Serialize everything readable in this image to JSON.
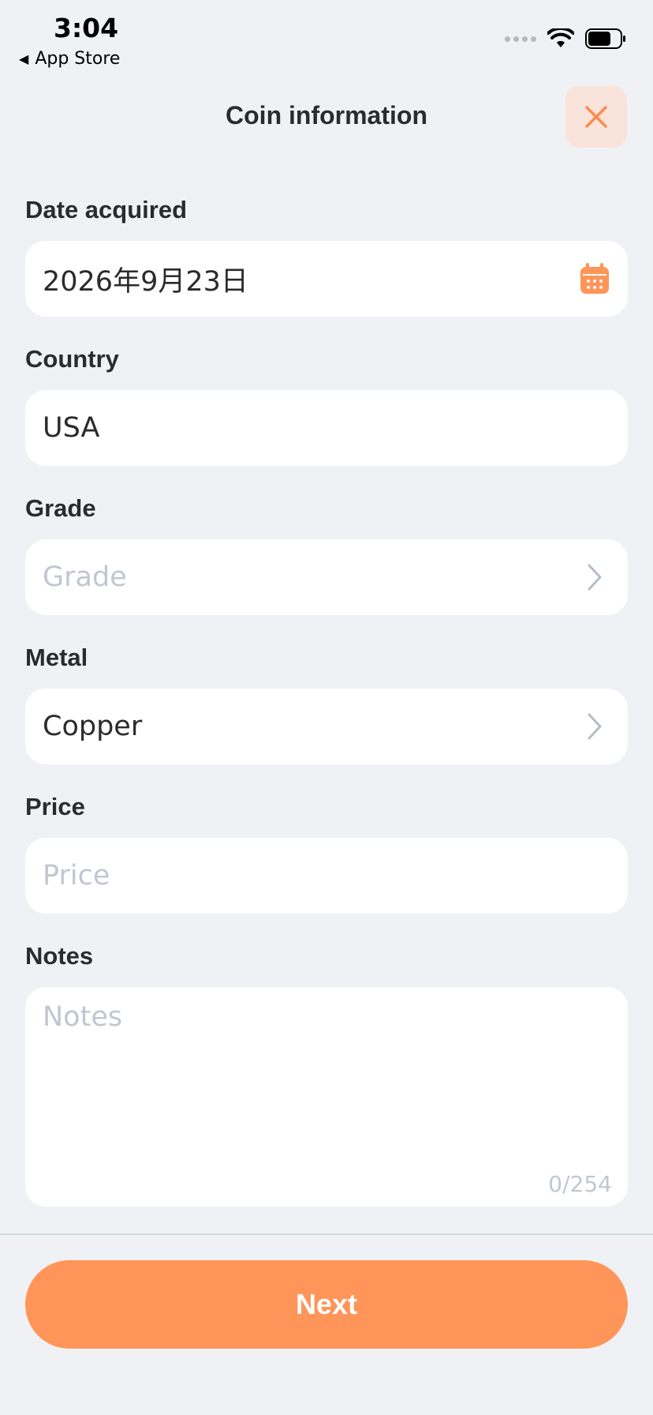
{
  "status_bar": {
    "time": "3:04",
    "back_app": "App Store"
  },
  "header": {
    "title": "Coin information",
    "close_icon": "close-icon"
  },
  "form": {
    "date_acquired": {
      "label": "Date acquired",
      "value": "2026年9月23日",
      "icon": "calendar-icon"
    },
    "country": {
      "label": "Country",
      "value": "USA"
    },
    "grade": {
      "label": "Grade",
      "placeholder": "Grade",
      "icon": "chevron-right-icon"
    },
    "metal": {
      "label": "Metal",
      "value": "Copper",
      "icon": "chevron-right-icon"
    },
    "price": {
      "label": "Price",
      "placeholder": "Price"
    },
    "notes": {
      "label": "Notes",
      "placeholder": "Notes",
      "counter": "0/254"
    }
  },
  "footer": {
    "next_label": "Next"
  },
  "colors": {
    "accent": "#ff9558",
    "background": "#f0f1f5",
    "close_bg": "#f9e3db",
    "placeholder": "#c2c6d1"
  }
}
